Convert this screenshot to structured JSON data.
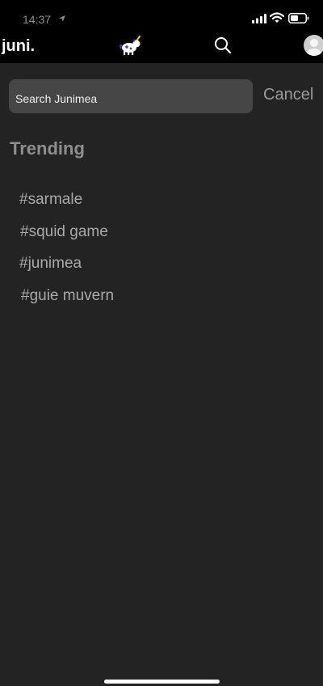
{
  "status_bar": {
    "time": "14:37",
    "icons": [
      "location-arrow-icon",
      "signal-icon",
      "wifi-icon",
      "battery-icon"
    ]
  },
  "nav": {
    "brand": "juni.",
    "icons": [
      "mascot-icon",
      "search-icon",
      "avatar-icon"
    ]
  },
  "search": {
    "placeholder": "Search Junimea",
    "value": "",
    "cancel_label": "Cancel"
  },
  "trending": {
    "title": "Trending",
    "tags": [
      "#sarmale",
      "#squid game",
      "#junimea",
      "#guie muvern"
    ]
  },
  "colors": {
    "background": "#232323",
    "topbar": "#000000",
    "search_field": "#464646",
    "muted_text": "#a9a9a9"
  }
}
